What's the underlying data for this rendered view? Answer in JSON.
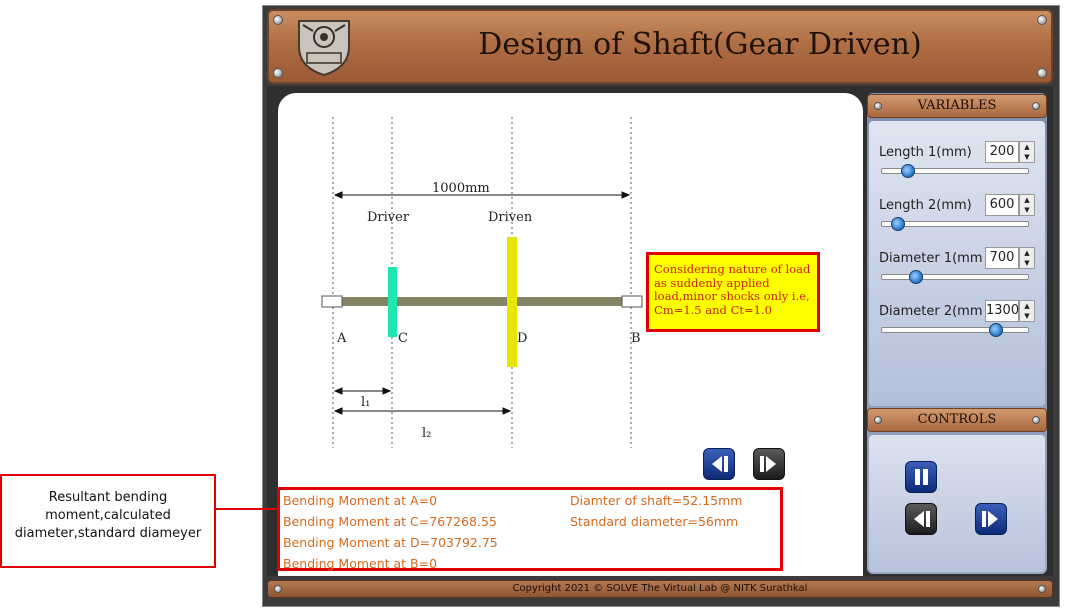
{
  "app": {
    "title": "Design of Shaft(Gear Driven)",
    "footer": "Copyright 2021 © SOLVE The Virtual Lab @ NITK Surathkal"
  },
  "diagram": {
    "total_length_label": "1000mm",
    "driver_label": "Driver",
    "driven_label": "Driven",
    "point_a": "A",
    "point_b": "B",
    "point_c": "C",
    "point_d": "D",
    "l1_label": "l₁",
    "l2_label": "l₂",
    "driver_color": "#1ee8b0",
    "driven_color": "#e6e600",
    "shaft_color": "#848464"
  },
  "note": {
    "text": "Considering nature of load as suddenly applied load,minor shocks only i.e, Cm=1.5 and Ct=1.0"
  },
  "variables": {
    "title": "VARIABLES",
    "items": [
      {
        "label": "Length 1(mm)",
        "value": "200",
        "fraction": 0.14
      },
      {
        "label": "Length 2(mm)",
        "value": "600",
        "fraction": 0.07
      },
      {
        "label": "Diameter 1(mm)",
        "value": "700",
        "fraction": 0.2
      },
      {
        "label": "Diameter 2(mm)",
        "value": "1300",
        "fraction": 0.8
      }
    ]
  },
  "controls": {
    "title": "CONTROLS"
  },
  "results": {
    "bm_a": "Bending Moment at A=0",
    "bm_c": "Bending Moment at C=767268.55",
    "bm_d": "Bending Moment at D=703792.75",
    "bm_b": "Bending Moment at B=0",
    "diameter": "Diamter of shaft=52.15mm",
    "standard": "Standard diameter=56mm"
  },
  "callout": {
    "text": "Resultant bending moment,calculated diameter,standard diameyer"
  }
}
